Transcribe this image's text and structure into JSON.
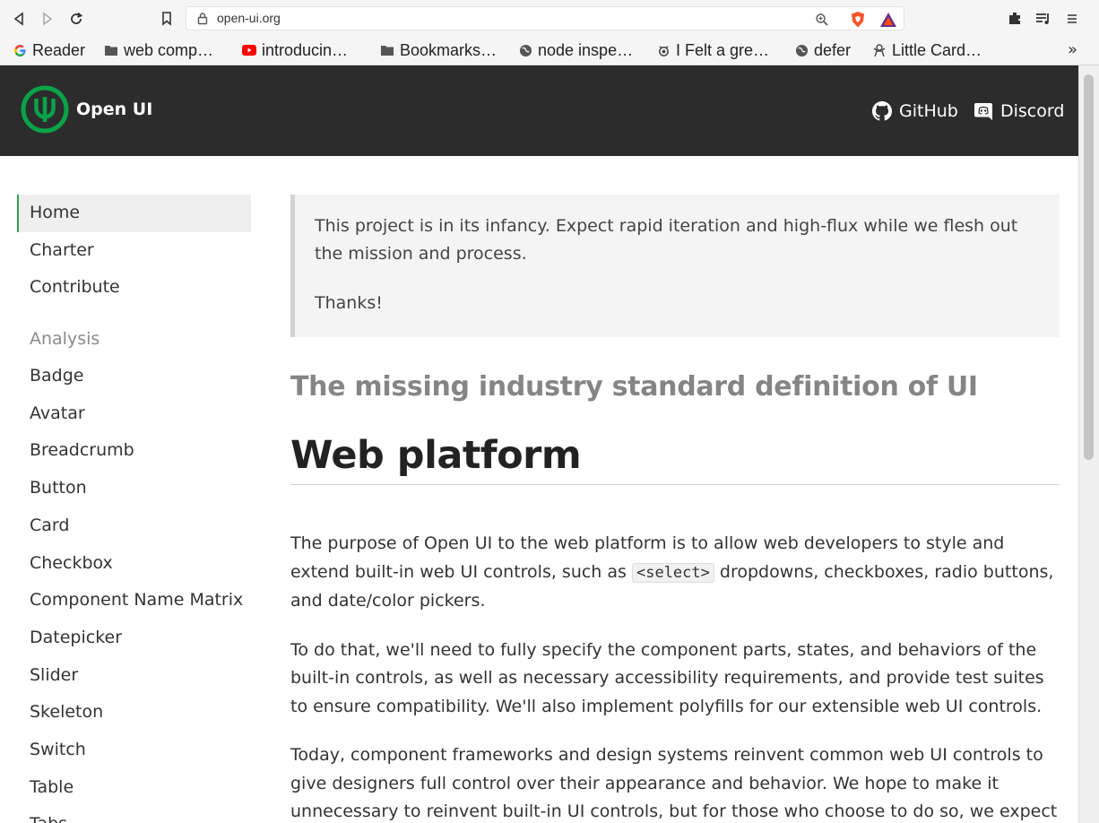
{
  "browser": {
    "url": "open-ui.org",
    "bookmarks": [
      {
        "label": "Reader",
        "icon": "google-icon"
      },
      {
        "label": "web comp…",
        "icon": "folder-icon"
      },
      {
        "label": "introducin…",
        "icon": "youtube-icon"
      },
      {
        "label": "Bookmarks…",
        "icon": "folder-icon"
      },
      {
        "label": "node inspe…",
        "icon": "globe-icon"
      },
      {
        "label": "I Felt a gre…",
        "icon": "site-icon"
      },
      {
        "label": "defer",
        "icon": "globe-icon"
      },
      {
        "label": "Little Card…",
        "icon": "site-icon"
      }
    ],
    "more_bookmarks": "»"
  },
  "header": {
    "brand": "Open UI",
    "links": [
      "GitHub",
      "Discord"
    ]
  },
  "sidebar": {
    "top_items": [
      "Home",
      "Charter",
      "Contribute"
    ],
    "section_heading": "Analysis",
    "analysis_items": [
      "Badge",
      "Avatar",
      "Breadcrumb",
      "Button",
      "Card",
      "Checkbox",
      "Component Name Matrix",
      "Datepicker",
      "Slider",
      "Skeleton",
      "Switch",
      "Table",
      "Tabs"
    ],
    "active": "Home"
  },
  "main": {
    "notice": {
      "text": "This project is in its infancy. Expect rapid iteration and high-flux while we flesh out the mission and process.",
      "thanks": "Thanks!"
    },
    "tagline": "The missing industry standard definition of UI",
    "heading": "Web platform",
    "p1_before": "The purpose of Open UI to the web platform is to allow web developers to style and extend built-in web UI controls, such as ",
    "p1_code": "<select>",
    "p1_after": " dropdowns, checkboxes, radio buttons, and date/color pickers.",
    "p2": "To do that, we'll need to fully specify the component parts, states, and behaviors of the built-in controls, as well as necessary accessibility requirements, and provide test suites to ensure compatibility. We'll also implement polyfills for our extensible web UI controls.",
    "p3": "Today, component frameworks and design systems reinvent common web UI controls to give designers full control over their appearance and behavior. We hope to make it unnecessary to reinvent built-in UI controls, but for those who choose to do so, we expect that these design"
  },
  "colors": {
    "header_bg": "#2c2c2c",
    "brand_green": "#0aa24a",
    "active_border": "#2ea44f"
  }
}
